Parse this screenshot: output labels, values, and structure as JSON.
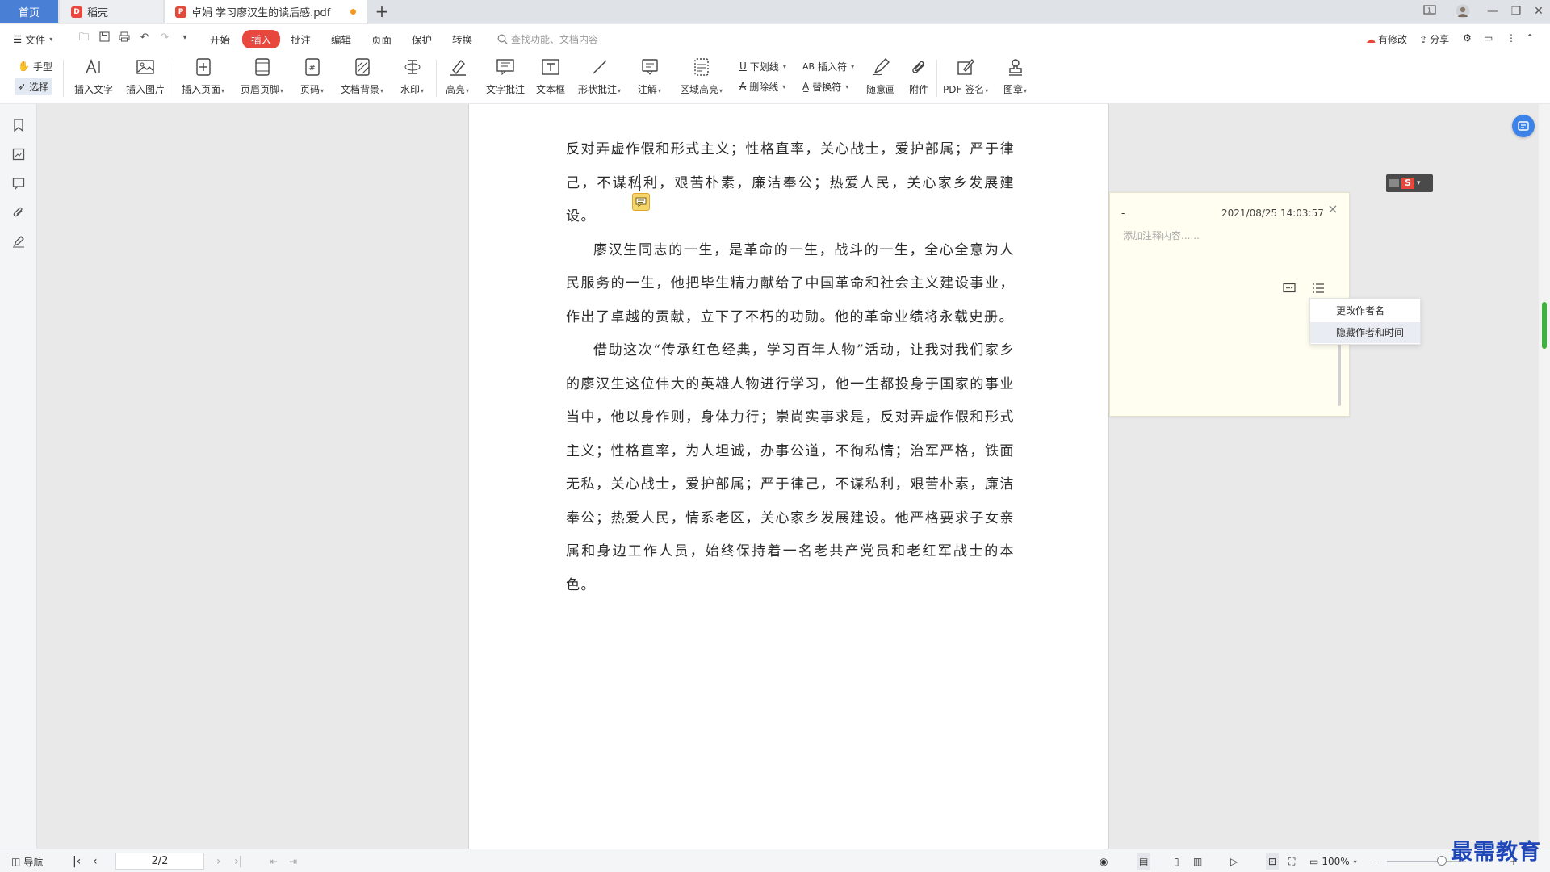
{
  "tabs": {
    "home": "首页",
    "docer": "稻壳",
    "pdf": "卓娟 学习廖汉生的读后感.pdf"
  },
  "menu": {
    "file": "文件",
    "items": [
      "开始",
      "插入",
      "批注",
      "编辑",
      "页面",
      "保护",
      "转换"
    ],
    "search_placeholder": "查找功能、文档内容",
    "modified": "有修改",
    "share": "分享"
  },
  "ribbon": {
    "hand": "手型",
    "select": "选择",
    "insert_text": "插入文字",
    "insert_image": "插入图片",
    "insert_page": "插入页面",
    "header_footer": "页眉页脚",
    "page_number": "页码",
    "doc_background": "文档背景",
    "watermark": "水印",
    "highlight": "高亮",
    "text_comment": "文字批注",
    "text_box": "文本框",
    "shape_comment": "形状批注",
    "annotation": "注解",
    "area_highlight": "区域高亮",
    "underline": "下划线",
    "strikethrough": "删除线",
    "insert_symbol": "插入符",
    "replace_symbol": "替换符",
    "freehand": "随意画",
    "attachment": "附件",
    "pdf_sign": "PDF 签名",
    "stamp": "图章"
  },
  "document": {
    "paragraphs": [
      {
        "indent": false,
        "text": "反对弄虚作假和形式主义；性格直率，关心战士，爱护部属；严于律己，不谋私利，艰苦朴素，廉洁奉公；热爱人民，关心家乡发展建设。"
      },
      {
        "indent": true,
        "text": "廖汉生同志的一生，是革命的一生，战斗的一生，全心全意为人民服务的一生，他把毕生精力献给了中国革命和社会主义建设事业，作出了卓越的贡献，立下了不朽的功勋。他的革命业绩将永载史册。"
      },
      {
        "indent": true,
        "text": "借助这次“传承红色经典，学习百年人物”活动，让我对我们家乡的廖汉生这位伟大的英雄人物进行学习，他一生都投身于国家的事业当中，他以身作则，身体力行；崇尚实事求是，反对弄虚作假和形式主义；性格直率，为人坦诚，办事公道，不徇私情；治军严格，铁面无私，关心战士，爱护部属；严于律己，不谋私利，艰苦朴素，廉洁奉公；热爱人民，情系老区，关心家乡发展建设。他严格要求子女亲属和身边工作人员，始终保持着一名老共产党员和老红军战士的本色。"
      }
    ]
  },
  "comment": {
    "author": "-",
    "time": "2021/08/25 14:03:57",
    "placeholder": "添加注释内容......",
    "menu": [
      "更改作者名",
      "隐藏作者和时间"
    ]
  },
  "statusbar": {
    "nav": "导航",
    "page": "2/2",
    "zoom": "100%"
  },
  "watermark_text": "最需教育",
  "colors": {
    "accent": "#e8473d",
    "home_tab": "#4a7fd6",
    "comment_bg": "#fffef0",
    "note_marker": "#f6d66a"
  }
}
